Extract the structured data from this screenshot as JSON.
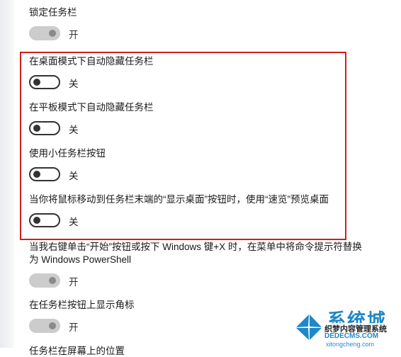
{
  "settings": [
    {
      "label": "锁定任务栏",
      "state": "开",
      "toggle": "on",
      "enabled": false
    },
    {
      "label": "在桌面模式下自动隐藏任务栏",
      "state": "关",
      "toggle": "off",
      "enabled": true
    },
    {
      "label": "在平板模式下自动隐藏任务栏",
      "state": "关",
      "toggle": "off",
      "enabled": true
    },
    {
      "label": "使用小任务栏按钮",
      "state": "关",
      "toggle": "off",
      "enabled": true
    },
    {
      "label": "当你将鼠标移动到任务栏末端的“显示桌面”按钮时，使用“速览”预览桌面",
      "state": "关",
      "toggle": "off",
      "enabled": true
    },
    {
      "label": "当我右键单击“开始”按钮或按下 Windows 键+X 时，在菜单中将命令提示符替换为 Windows PowerShell",
      "state": "开",
      "toggle": "on",
      "enabled": false
    },
    {
      "label": "在任务栏按钮上显示角标",
      "state": "开",
      "toggle": "on",
      "enabled": false
    }
  ],
  "partial_label": "任务栏在屏幕上的位置",
  "watermark": {
    "brand": "系统城",
    "line1": "织梦内容管理系统",
    "line2": "DEDECMS.COM",
    "line3": "xitongcheng.com"
  },
  "colors": {
    "highlight": "#d0201e",
    "accent_blue": "#1e88c8"
  }
}
